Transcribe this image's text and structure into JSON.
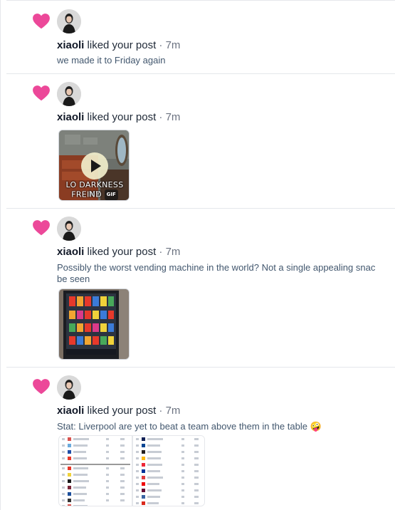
{
  "colors": {
    "heart": "#ec4899",
    "text": "#1f2937",
    "muted": "#6b7280",
    "post_text": "#42576e",
    "divider": "#e5e7eb"
  },
  "notifications": [
    {
      "username": "xiaoli",
      "action": " liked your post",
      "time": " · 7m",
      "text": "we made it to Friday again",
      "icon": "heart-icon"
    },
    {
      "username": "xiaoli",
      "action": " liked your post",
      "time": " · 7m",
      "media": {
        "kind": "gif",
        "caption_line1": "LO DARKNESS MY",
        "caption_line2": "FREIND",
        "badge": "GIF",
        "icon": "play-icon"
      }
    },
    {
      "username": "xiaoli",
      "action": " liked your post",
      "time": " · 7m",
      "text_line1": "Possibly the worst vending machine in the world? Not a single appealing snac",
      "text_line2": "be seen",
      "media": {
        "kind": "image",
        "icon": "vending-machine-image"
      }
    },
    {
      "username": "xiaoli",
      "action": " liked your post",
      "time": " · 7m",
      "text": "Stat: Liverpool are yet to beat a team above them in the table 🤪",
      "media": {
        "kind": "image",
        "icon": "league-table-image"
      }
    }
  ]
}
